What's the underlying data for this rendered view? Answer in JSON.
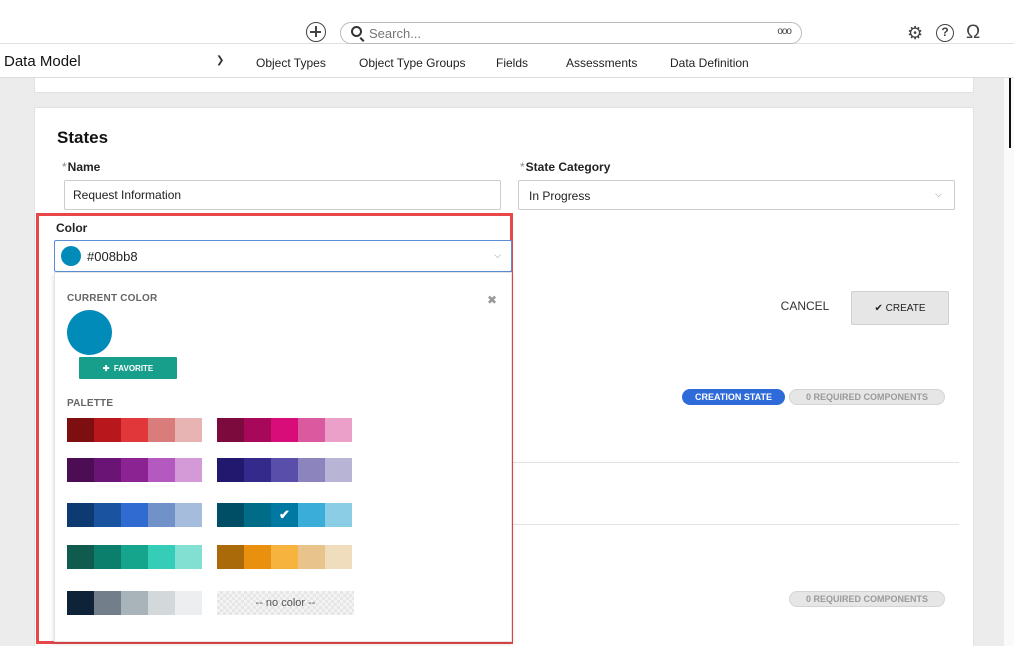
{
  "topbar": {
    "search_placeholder": "Search...",
    "more_label": "ooo"
  },
  "navbar": {
    "module": "Data Model",
    "tabs": [
      {
        "label": "Object Types"
      },
      {
        "label": "Object Type Groups"
      },
      {
        "label": "Fields"
      },
      {
        "label": "Assessments"
      },
      {
        "label": "Data Definition"
      }
    ]
  },
  "form": {
    "title": "States",
    "name_label": "Name",
    "name_value": "Request Information",
    "category_label": "State Category",
    "category_value": "In Progress",
    "required_mark": "*",
    "cancel_label": "CANCEL",
    "create_label": "CREATE",
    "badges": {
      "creation_state": "CREATION STATE",
      "required_components_1": "0 REQUIRED COMPONENTS",
      "required_components_2": "0 REQUIRED COMPONENTS"
    }
  },
  "color_picker": {
    "label": "Color",
    "value": "#008bb8",
    "current_color_label": "CURRENT COLOR",
    "current_color": "#008bb8",
    "favorite_label": "FAVORITE",
    "palette_label": "PALETTE",
    "no_color_label": "-- no color --",
    "selected_swatch": "#0079a2",
    "palette": [
      [
        "#7e0f10",
        "#b8171c",
        "#e2373a",
        "#d97c7c",
        "#e8b3b3"
      ],
      [
        "#7c0a3c",
        "#a8085a",
        "#d80d7a",
        "#db5a9f",
        "#eaa0c8"
      ],
      [
        "#4c0d54",
        "#6a1476",
        "#8c2393",
        "#b359c0",
        "#d49ad8"
      ],
      [
        "#22186d",
        "#332a8c",
        "#5a4eab",
        "#8b84bd",
        "#b8b4d6"
      ],
      [
        "#0e3a72",
        "#1a53a0",
        "#2f6bd0",
        "#7191c9",
        "#a5bcdd"
      ],
      [
        "#004e66",
        "#006c88",
        "#0079a2",
        "#3aaed8",
        "#8ccde6"
      ],
      [
        "#0f5c4f",
        "#0b7f6c",
        "#14a58c",
        "#35cdb7",
        "#82e0d3"
      ],
      [
        "#aa6a0a",
        "#e9900f",
        "#f6b33e",
        "#e9c38c",
        "#f0ddbd"
      ],
      [
        "#0e2238",
        "#727f8a",
        "#a9b3ba",
        "#d3d8db",
        "#eceeef"
      ]
    ]
  },
  "colors": {
    "accent_blue": "#2f6bd8",
    "teal": "#179f8c",
    "highlight_red": "#e8474a"
  }
}
